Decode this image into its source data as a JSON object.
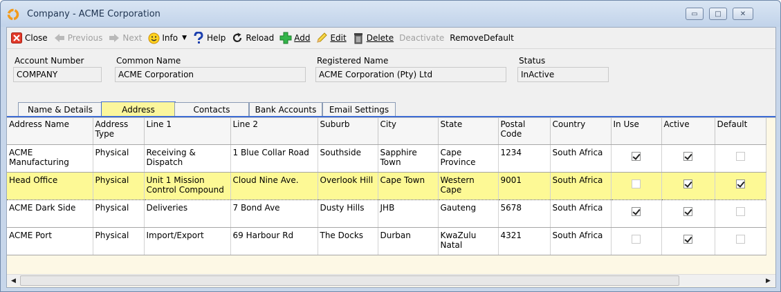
{
  "window": {
    "title": "Company - ACME Corporation",
    "buttons": {
      "minimize": "▭",
      "maximize": "□",
      "close": "✕"
    }
  },
  "toolbar": {
    "close": "Close",
    "previous": "Previous",
    "next": "Next",
    "info": "Info",
    "help": "Help",
    "reload": "Reload",
    "add": "Add",
    "edit": "Edit",
    "delete": "Delete",
    "deactivate": "Deactivate",
    "remove_default": "RemoveDefault"
  },
  "fields": {
    "account_number": {
      "label": "Account Number",
      "value": "COMPANY"
    },
    "common_name": {
      "label": "Common Name",
      "value": "ACME Corporation"
    },
    "registered_name": {
      "label": "Registered Name",
      "value": "ACME Corporation (Pty) Ltd"
    },
    "status": {
      "label": "Status",
      "value": "InActive"
    }
  },
  "tabs": [
    {
      "label": "Name & Details"
    },
    {
      "label": "Address",
      "active": true
    },
    {
      "label": "Contacts"
    },
    {
      "label": "Bank Accounts"
    },
    {
      "label": "Email Settings"
    }
  ],
  "grid": {
    "columns": [
      "Address Name",
      "Address Type",
      "Line 1",
      "Line 2",
      "Suburb",
      "City",
      "State",
      "Postal Code",
      "Country",
      "In Use",
      "Active",
      "Default"
    ],
    "rows": [
      {
        "address_name": "ACME Manufacturing",
        "type": "Physical",
        "line1": "Receiving & Dispatch",
        "line2": "1 Blue Collar Road",
        "suburb": "Southside",
        "city": "Sapphire Town",
        "state": "Cape Province",
        "postal": "1234",
        "country": "South Africa",
        "in_use": true,
        "active": true,
        "default": false
      },
      {
        "address_name": "Head Office",
        "type": "Physical",
        "line1": "Unit 1 Mission Control Compound",
        "line2": "Cloud Nine Ave.",
        "suburb": "Overlook Hill",
        "city": "Cape Town",
        "state": "Western Cape",
        "postal": "9001",
        "country": "South Africa",
        "in_use": false,
        "active": true,
        "default": true,
        "selected": true
      },
      {
        "address_name": "ACME Dark Side",
        "type": "Physical",
        "line1": "Deliveries",
        "line2": "7 Bond Ave",
        "suburb": "Dusty Hills",
        "city": "JHB",
        "state": "Gauteng",
        "postal": "5678",
        "country": "South Africa",
        "in_use": true,
        "active": true,
        "default": false
      },
      {
        "address_name": "ACME Port",
        "type": "Physical",
        "line1": "Import/Export",
        "line2": "69 Harbour Rd",
        "suburb": "The Docks",
        "city": "Durban",
        "state": "KwaZulu Natal",
        "postal": "4321",
        "country": "South Africa",
        "in_use": false,
        "active": true,
        "default": false
      }
    ]
  },
  "scrollbar": {
    "left": "◀",
    "right": "▶"
  },
  "colors": {
    "selected_row": "#fdf995",
    "active_tab": "#fbf69c",
    "tab_underline": "#3c6bd4",
    "grid_bg": "#fdf8e5"
  }
}
